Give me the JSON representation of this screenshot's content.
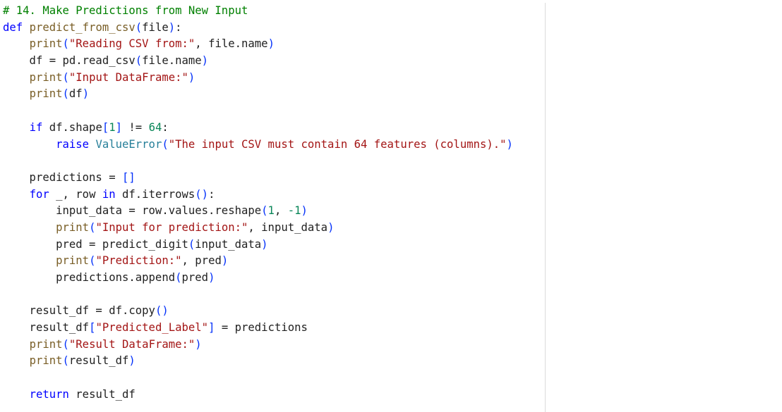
{
  "editor": {
    "lines": [
      [
        {
          "t": "# 14. Make Predictions from New Input",
          "c": "comment"
        }
      ],
      [
        {
          "t": "def",
          "c": "keyword"
        },
        {
          "t": " ",
          "c": "plain"
        },
        {
          "t": "predict_from_csv",
          "c": "func"
        },
        {
          "t": "(",
          "c": "paren"
        },
        {
          "t": "file",
          "c": "plain"
        },
        {
          "t": ")",
          "c": "paren"
        },
        {
          "t": ":",
          "c": "plain"
        }
      ],
      [
        {
          "t": "    ",
          "c": "plain"
        },
        {
          "t": "print",
          "c": "builtin"
        },
        {
          "t": "(",
          "c": "paren"
        },
        {
          "t": "\"Reading CSV from:\"",
          "c": "string"
        },
        {
          "t": ", file.name",
          "c": "plain"
        },
        {
          "t": ")",
          "c": "paren"
        }
      ],
      [
        {
          "t": "    df = pd.read_csv",
          "c": "plain"
        },
        {
          "t": "(",
          "c": "paren"
        },
        {
          "t": "file.name",
          "c": "plain"
        },
        {
          "t": ")",
          "c": "paren"
        }
      ],
      [
        {
          "t": "    ",
          "c": "plain"
        },
        {
          "t": "print",
          "c": "builtin"
        },
        {
          "t": "(",
          "c": "paren"
        },
        {
          "t": "\"Input DataFrame:\"",
          "c": "string"
        },
        {
          "t": ")",
          "c": "paren"
        }
      ],
      [
        {
          "t": "    ",
          "c": "plain"
        },
        {
          "t": "print",
          "c": "builtin"
        },
        {
          "t": "(",
          "c": "paren"
        },
        {
          "t": "df",
          "c": "plain"
        },
        {
          "t": ")",
          "c": "paren"
        }
      ],
      [],
      [
        {
          "t": "    ",
          "c": "plain"
        },
        {
          "t": "if",
          "c": "keyword"
        },
        {
          "t": " df.shape",
          "c": "plain"
        },
        {
          "t": "[",
          "c": "paren"
        },
        {
          "t": "1",
          "c": "number"
        },
        {
          "t": "]",
          "c": "paren"
        },
        {
          "t": " != ",
          "c": "plain"
        },
        {
          "t": "64",
          "c": "number"
        },
        {
          "t": ":",
          "c": "plain"
        }
      ],
      [
        {
          "t": "        ",
          "c": "plain"
        },
        {
          "t": "raise",
          "c": "keyword"
        },
        {
          "t": " ",
          "c": "plain"
        },
        {
          "t": "ValueError",
          "c": "class"
        },
        {
          "t": "(",
          "c": "paren"
        },
        {
          "t": "\"The input CSV must contain 64 features (columns).\"",
          "c": "string"
        },
        {
          "t": ")",
          "c": "paren"
        }
      ],
      [],
      [
        {
          "t": "    predictions = ",
          "c": "plain"
        },
        {
          "t": "[]",
          "c": "paren"
        }
      ],
      [
        {
          "t": "    ",
          "c": "plain"
        },
        {
          "t": "for",
          "c": "keyword"
        },
        {
          "t": " _, row ",
          "c": "plain"
        },
        {
          "t": "in",
          "c": "keyword"
        },
        {
          "t": " df.iterrows",
          "c": "plain"
        },
        {
          "t": "()",
          "c": "paren"
        },
        {
          "t": ":",
          "c": "plain"
        }
      ],
      [
        {
          "t": "        input_data = row.values.reshape",
          "c": "plain"
        },
        {
          "t": "(",
          "c": "paren"
        },
        {
          "t": "1",
          "c": "number"
        },
        {
          "t": ", ",
          "c": "plain"
        },
        {
          "t": "-1",
          "c": "number"
        },
        {
          "t": ")",
          "c": "paren"
        }
      ],
      [
        {
          "t": "        ",
          "c": "plain"
        },
        {
          "t": "print",
          "c": "builtin"
        },
        {
          "t": "(",
          "c": "paren"
        },
        {
          "t": "\"Input for prediction:\"",
          "c": "string"
        },
        {
          "t": ", input_data",
          "c": "plain"
        },
        {
          "t": ")",
          "c": "paren"
        }
      ],
      [
        {
          "t": "        pred = predict_digit",
          "c": "plain"
        },
        {
          "t": "(",
          "c": "paren"
        },
        {
          "t": "input_data",
          "c": "plain"
        },
        {
          "t": ")",
          "c": "paren"
        }
      ],
      [
        {
          "t": "        ",
          "c": "plain"
        },
        {
          "t": "print",
          "c": "builtin"
        },
        {
          "t": "(",
          "c": "paren"
        },
        {
          "t": "\"Prediction:\"",
          "c": "string"
        },
        {
          "t": ", pred",
          "c": "plain"
        },
        {
          "t": ")",
          "c": "paren"
        }
      ],
      [
        {
          "t": "        predictions.append",
          "c": "plain"
        },
        {
          "t": "(",
          "c": "paren"
        },
        {
          "t": "pred",
          "c": "plain"
        },
        {
          "t": ")",
          "c": "paren"
        }
      ],
      [],
      [
        {
          "t": "    result_df = df.copy",
          "c": "plain"
        },
        {
          "t": "()",
          "c": "paren"
        }
      ],
      [
        {
          "t": "    result_df",
          "c": "plain"
        },
        {
          "t": "[",
          "c": "paren"
        },
        {
          "t": "\"Predicted_Label\"",
          "c": "string"
        },
        {
          "t": "]",
          "c": "paren"
        },
        {
          "t": " = predictions",
          "c": "plain"
        }
      ],
      [
        {
          "t": "    ",
          "c": "plain"
        },
        {
          "t": "print",
          "c": "builtin"
        },
        {
          "t": "(",
          "c": "paren"
        },
        {
          "t": "\"Result DataFrame:\"",
          "c": "string"
        },
        {
          "t": ")",
          "c": "paren"
        }
      ],
      [
        {
          "t": "    ",
          "c": "plain"
        },
        {
          "t": "print",
          "c": "builtin"
        },
        {
          "t": "(",
          "c": "paren"
        },
        {
          "t": "result_df",
          "c": "plain"
        },
        {
          "t": ")",
          "c": "paren"
        }
      ],
      [],
      [
        {
          "t": "    ",
          "c": "plain"
        },
        {
          "t": "return",
          "c": "keyword"
        },
        {
          "t": " result_df",
          "c": "plain"
        }
      ]
    ]
  }
}
